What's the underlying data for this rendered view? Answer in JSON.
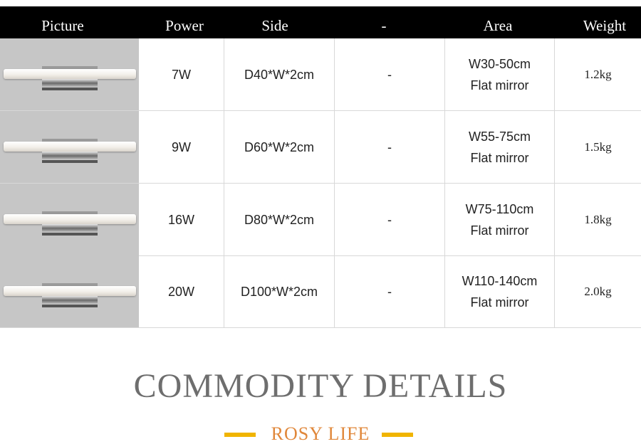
{
  "table": {
    "headers": [
      "Picture",
      "Power",
      "Side",
      "-",
      "Area",
      "Weight"
    ],
    "rows": [
      {
        "power": "7W",
        "side": "D40*W*2cm",
        "dash": "-",
        "area_line1": "W30-50cm",
        "area_line2": "Flat mirror",
        "weight": "1.2kg"
      },
      {
        "power": "9W",
        "side": "D60*W*2cm",
        "dash": "-",
        "area_line1": "W55-75cm",
        "area_line2": "Flat mirror",
        "weight": "1.5kg"
      },
      {
        "power": "16W",
        "side": "D80*W*2cm",
        "dash": "-",
        "area_line1": "W75-110cm",
        "area_line2": "Flat mirror",
        "weight": "1.8kg"
      },
      {
        "power": "20W",
        "side": "D100*W*2cm",
        "dash": "-",
        "area_line1": "W110-140cm",
        "area_line2": "Flat mirror",
        "weight": "2.0kg"
      }
    ]
  },
  "section": {
    "title": "COMMODITY DETAILS",
    "subtitle": "ROSY LIFE"
  },
  "colors": {
    "header_bg": "#000000",
    "subtitle": "#e0873a",
    "accent_bar": "#f0b400",
    "title": "#6e6e6e"
  }
}
